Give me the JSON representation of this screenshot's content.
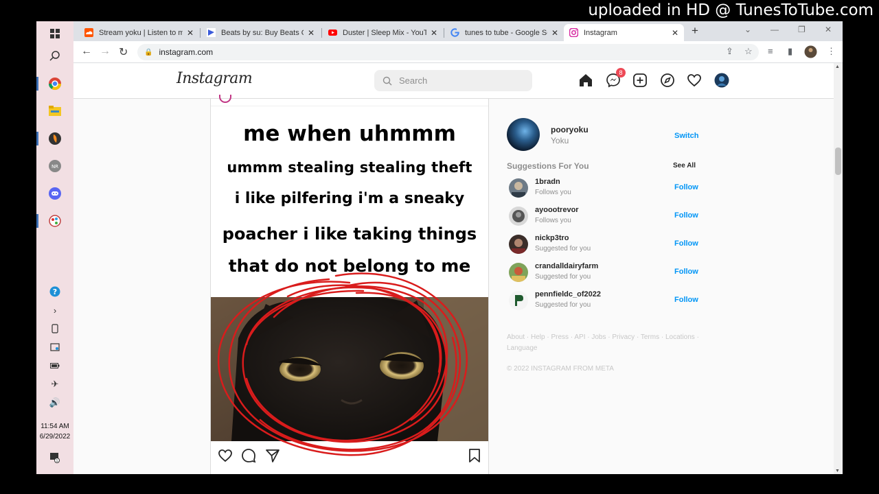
{
  "watermark": "uploaded in HD @ TunesToTube.com",
  "taskbar": {
    "clock_time": "11:54 AM",
    "clock_date": "6/29/2022",
    "notification_count": "1"
  },
  "browser": {
    "tabs": [
      {
        "title": "Stream yoku | Listen to mu",
        "icon": "soundcloud-icon"
      },
      {
        "title": "Beats by su: Buy Beats Onl",
        "icon": "beatstars-icon"
      },
      {
        "title": "Duster | Sleep Mix - YouTu",
        "icon": "youtube-icon"
      },
      {
        "title": "tunes to tube - Google Sea",
        "icon": "google-icon"
      },
      {
        "title": "Instagram",
        "icon": "instagram-icon"
      }
    ],
    "url": "instagram.com"
  },
  "instagram": {
    "logo": "Instagram",
    "search_placeholder": "Search",
    "messages_badge": "8",
    "post": {
      "meme_lines": [
        "me when uhmmm",
        "ummm stealing stealing theft",
        "i like pilfering i'm a sneaky",
        "poacher i like taking things",
        "that do not belong to me"
      ]
    },
    "sidebar": {
      "username": "pooryoku",
      "name": "Yoku",
      "switch_label": "Switch",
      "suggestions_heading": "Suggestions For You",
      "see_all_label": "See All",
      "suggestions": [
        {
          "username": "1bradn",
          "subtitle": "Follows you",
          "action": "Follow"
        },
        {
          "username": "ayoootrevor",
          "subtitle": "Follows you",
          "action": "Follow"
        },
        {
          "username": "nickp3tro",
          "subtitle": "Suggested for you",
          "action": "Follow"
        },
        {
          "username": "crandalldairyfarm",
          "subtitle": "Suggested for you",
          "action": "Follow"
        },
        {
          "username": "pennfieldc_of2022",
          "subtitle": "Suggested for you",
          "action": "Follow"
        }
      ],
      "footer_links": "About · Help · Press · API · Jobs · Privacy · Terms · Locations · Language",
      "copyright": "© 2022 INSTAGRAM FROM META"
    }
  },
  "colors": {
    "accent_blue": "#0095f6",
    "badge_red": "#ed4956",
    "taskbar_pink": "#f2dfe3",
    "scribble_red": "#d91c1c"
  }
}
